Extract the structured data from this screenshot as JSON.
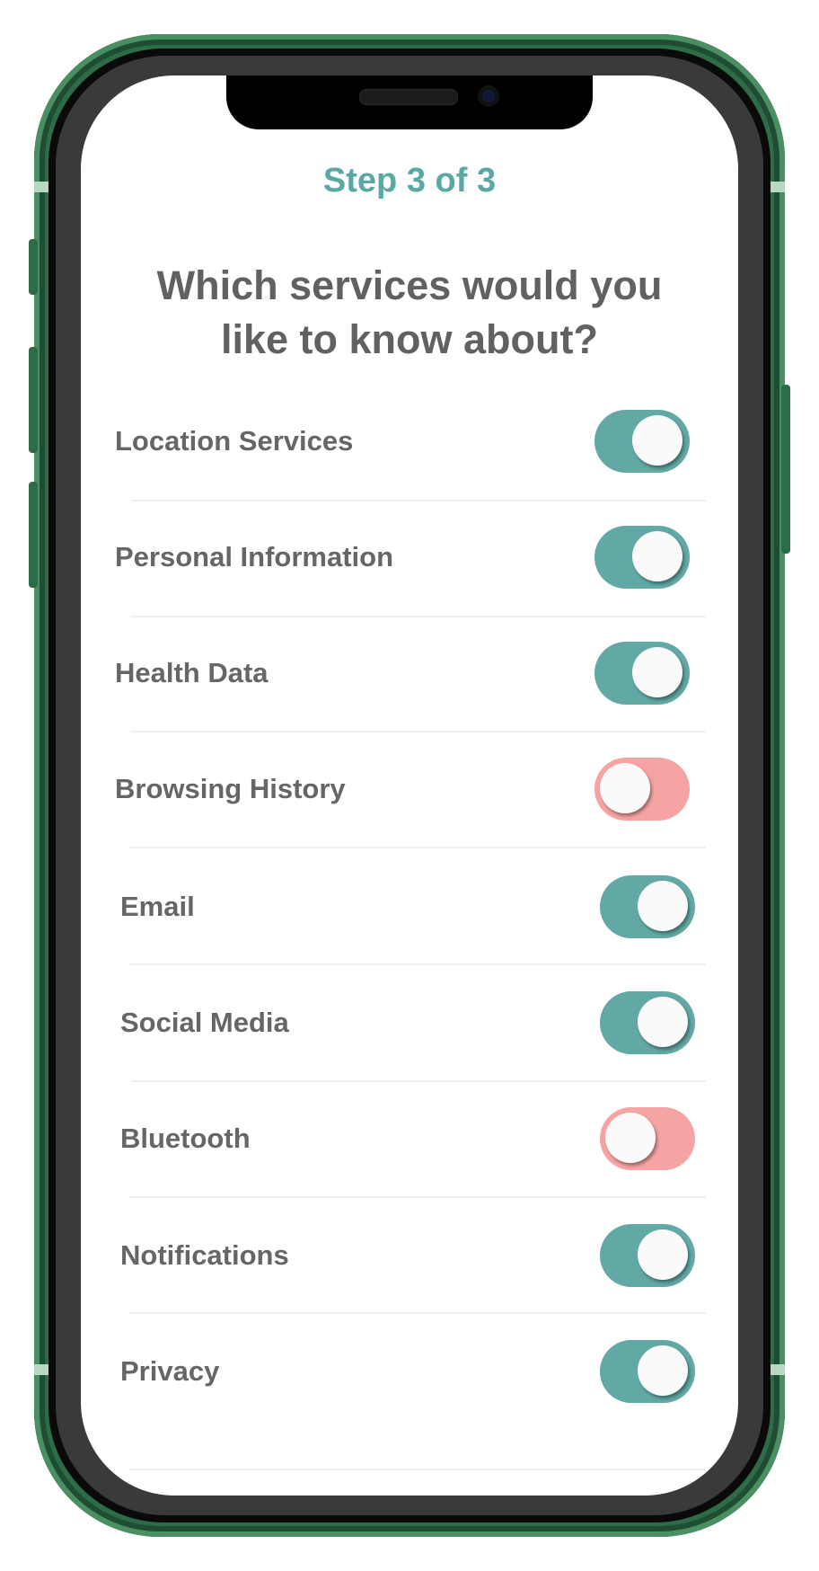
{
  "header": {
    "step": "Step 3 of 3",
    "question_line1": "Which services would you",
    "question_line2": "like to know about?"
  },
  "colors": {
    "accent": "#5aa8a4",
    "toggle_on": "#62a9a6",
    "toggle_off": "#f5a3a3",
    "frame": "#2e6b47"
  },
  "services": [
    {
      "label": "Location Services",
      "enabled": true
    },
    {
      "label": "Personal Information",
      "enabled": true
    },
    {
      "label": "Health Data",
      "enabled": true
    },
    {
      "label": "Browsing History",
      "enabled": false
    },
    {
      "label": "Email",
      "enabled": true
    },
    {
      "label": "Social Media",
      "enabled": true
    },
    {
      "label": "Bluetooth",
      "enabled": false
    },
    {
      "label": "Notifications",
      "enabled": true
    },
    {
      "label": "Privacy",
      "enabled": true
    }
  ]
}
